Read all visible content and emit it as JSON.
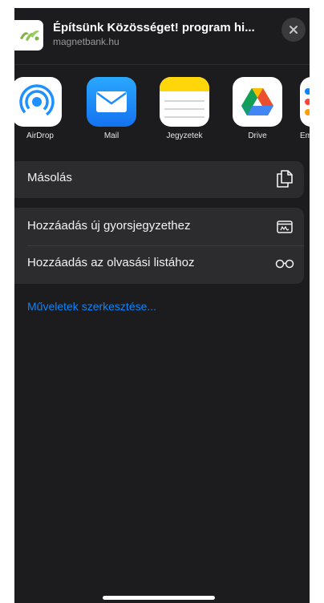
{
  "header": {
    "title": "Építsünk Közösséget! program hi...",
    "subtitle": "magnetbank.hu",
    "site_icon": "green-leaf-logo",
    "close_icon": "xmark-icon"
  },
  "apps": [
    {
      "label": "AirDrop",
      "icon": "airdrop-icon",
      "color": "#ffffff"
    },
    {
      "label": "Mail",
      "icon": "mail-icon",
      "color": "#1a8cff"
    },
    {
      "label": "Jegyzetek",
      "icon": "notes-icon",
      "color": "#ffd60a"
    },
    {
      "label": "Drive",
      "icon": "drive-icon",
      "color": "#ffffff"
    },
    {
      "label": "Eml",
      "icon": "reminders-icon",
      "color": "#ffffff"
    }
  ],
  "actions": {
    "copy": {
      "label": "Másolás",
      "icon": "copy-doc-icon"
    },
    "quick_note": {
      "label": "Hozzáadás új gyorsjegyzethez",
      "icon": "quick-note-icon"
    },
    "reading_list": {
      "label": "Hozzáadás az olvasási listához",
      "icon": "glasses-icon"
    }
  },
  "edit_actions": {
    "label": "Műveletek szerkesztése..."
  },
  "colors": {
    "sheet_bg": "#1c1c1e",
    "group_bg": "#2c2c2e",
    "link": "#0a84ff",
    "text": "#f2f2f7"
  }
}
